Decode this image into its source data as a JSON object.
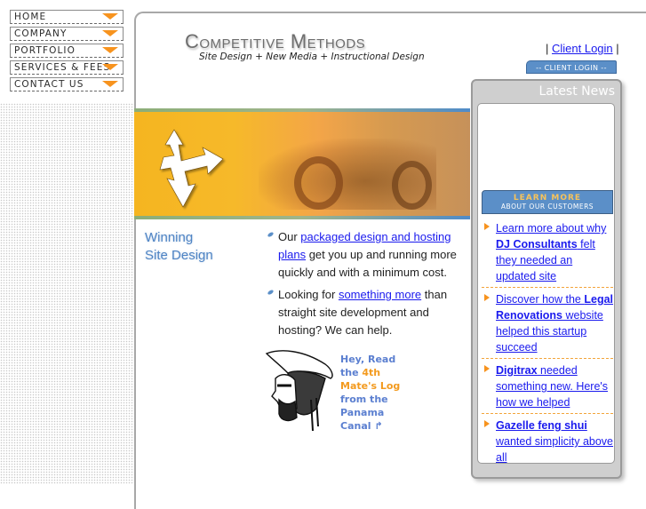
{
  "nav": {
    "items": [
      {
        "label": "HOME"
      },
      {
        "label": "COMPANY"
      },
      {
        "label": "PORTFOLIO"
      },
      {
        "label": "SERVICES & FEES"
      },
      {
        "label": "CONTACT US"
      }
    ]
  },
  "header": {
    "brand": "Competitive Methods",
    "tagline": "Site Design + New Media + Instructional Design",
    "login_prefix": "| ",
    "login_link": "Client Login",
    "login_suffix": " |",
    "login_button": "-- CLIENT LOGIN --"
  },
  "section": {
    "title_line1": "Winning",
    "title_line2": "Site Design",
    "bullets": [
      {
        "pre": "Our ",
        "link": "packaged design and hosting plans",
        "post": " get you up and running more quickly and with a minimum cost."
      },
      {
        "pre": "Looking for ",
        "link": "something more",
        "post": " than straight site development and hosting? We can help."
      }
    ]
  },
  "promo": {
    "line1": "Hey, Read",
    "line2_pre": "the ",
    "line2_hl": "4th",
    "line3": "Mate's Log",
    "line4": "from the",
    "line5": "Panama",
    "line6": "Canal",
    "arrow": "↱"
  },
  "news": {
    "title": "Latest News",
    "learn_main": "LEARN MORE",
    "learn_sub": "ABOUT OUR CUSTOMERS",
    "items": [
      {
        "pre": "Learn more about why ",
        "bold": "DJ Consultants",
        "post": " felt they needed an updated site"
      },
      {
        "pre": "Discover how the ",
        "bold": "Legal Renovations",
        "post": " website helped this startup succeed"
      },
      {
        "pre": "",
        "bold": "Digitrax",
        "post": " needed something new. Here's how we helped"
      },
      {
        "pre": "",
        "bold": "Gazelle feng shui",
        "post": " wanted simplicity above all"
      }
    ]
  },
  "colors": {
    "accent_orange": "#f7931e",
    "link_blue": "#1a1aee",
    "heading_blue": "#4f84c4",
    "button_blue": "#5b8fc8"
  }
}
